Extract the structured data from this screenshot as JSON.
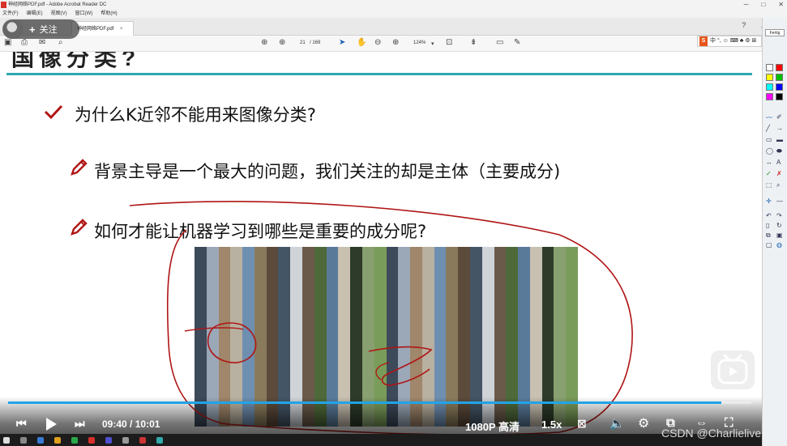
{
  "window": {
    "title": "神经网络PDF.pdf - Adobe Acrobat Reader DC",
    "controls": [
      "─",
      "□",
      "✕"
    ]
  },
  "menu": [
    "文件(F)",
    "编辑(E)",
    "视图(V)",
    "窗口(W)",
    "帮助(H)"
  ],
  "tab": {
    "label": "神经网络PDF.pdf",
    "close": "×"
  },
  "follow": {
    "label": "关注",
    "plus": "+"
  },
  "reader_toolbar": {
    "page_current": "21",
    "page_total": "/ 169",
    "zoom": "124%"
  },
  "ime": {
    "logo": "S",
    "items": "中 °, ☺ ⌨ ♣ ⚙ ⊞"
  },
  "side_panel": {
    "font_label": "Fertig",
    "colors": [
      "#ffffff",
      "#ff0000",
      "#ffff00",
      "#00c000",
      "#00ffff",
      "#0000ff",
      "#ff00ff",
      "#000000"
    ]
  },
  "slide": {
    "title_fragment": "国像分类?",
    "bullets": [
      "为什么K近邻不能用来图像分类?",
      "背景主导是一个最大的问题，我们关注的却是主体（主要成分)",
      "如何才能让机器学习到哪些是重要的成分呢?"
    ],
    "accent": "#2fa7b0",
    "annotation_color": "#b01515"
  },
  "player": {
    "progress": 0.96,
    "current_time": "09:40",
    "separator": "/",
    "total_time": "10:01",
    "quality": "1080P 高清",
    "speed": "1.5x"
  },
  "watermark": "CSDN @Charlielive"
}
